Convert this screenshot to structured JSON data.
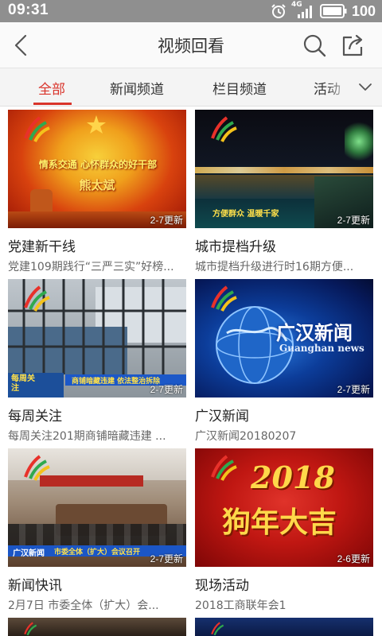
{
  "status_bar": {
    "time": "09:31",
    "network": "4G",
    "battery_percent": "100"
  },
  "header": {
    "title": "视频回看",
    "icons": [
      "back-arrow-icon",
      "search-icon",
      "share-icon"
    ]
  },
  "tabs": [
    {
      "label": "全部",
      "active": true
    },
    {
      "label": "新闻频道",
      "active": false
    },
    {
      "label": "栏目频道",
      "active": false
    },
    {
      "label": "活动",
      "active": false
    }
  ],
  "colors": {
    "accent": "#d9342b",
    "status_bar": "#8f8f8f"
  },
  "videos": [
    {
      "title": "党建新干线",
      "description": "党建109期践行“三严三实”好榜...",
      "badge": "2-7更新",
      "thumb_text_1": "情系交通 心怀群众的好干部",
      "thumb_text_2": "熊太斌"
    },
    {
      "title": "城市提档升级",
      "description": "城市提档升级进行时16期方便...",
      "badge": "2-7更新",
      "thumb_text_1": "方便群众 温暖千家"
    },
    {
      "title": "每周关注",
      "description": "每周关注201期商铺暗藏违建  ...",
      "badge": "2-7更新",
      "thumb_text_1": "每周关注",
      "thumb_text_2": "商铺暗藏违建 依法整治拆除"
    },
    {
      "title": "广汉新闻",
      "description": "广汉新闻20180207",
      "badge": "2-7更新",
      "thumb_text_1": "广汉新闻",
      "thumb_text_2": "Guanghan news"
    },
    {
      "title": "新闻快讯",
      "description": "2月7日   市委全体（扩大）会...",
      "badge": "2-7更新",
      "thumb_text_1": "广汉新闻",
      "thumb_text_2": "市委全体（扩大）会议召开"
    },
    {
      "title": "现场活动",
      "description": "2018工商联年会1",
      "badge": "2-6更新",
      "thumb_text_1": "2018",
      "thumb_text_2": "狗年大吉"
    }
  ]
}
